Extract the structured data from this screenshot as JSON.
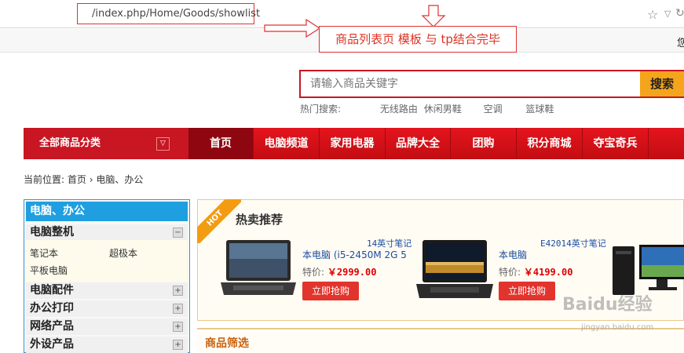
{
  "browser": {
    "url": "/index.php/Home/Goods/showlist",
    "corner_char": "您"
  },
  "annotation": {
    "text": "商品列表页  模板 与 tp结合完毕"
  },
  "search": {
    "placeholder": "请输入商品关键字",
    "button": "搜索",
    "hot_label": "热门搜索:",
    "hot_terms": [
      "无线路由",
      "休闲男鞋",
      "空调",
      "篮球鞋"
    ]
  },
  "nav": {
    "all_categories": "全部商品分类",
    "items": [
      "首页",
      "电脑频道",
      "家用电器",
      "品牌大全",
      "团购",
      "积分商城",
      "夺宝奇兵"
    ]
  },
  "breadcrumb": {
    "label": "当前位置:",
    "home": "首页",
    "sep": "›",
    "current": "电脑、办公"
  },
  "sidebar": {
    "title": "电脑、办公",
    "categories": [
      {
        "name": "电脑整机",
        "expanded": true,
        "subs": [
          "笔记本",
          "超极本",
          "平板电脑"
        ]
      },
      {
        "name": "电脑配件",
        "expanded": false
      },
      {
        "name": "办公打印",
        "expanded": false
      },
      {
        "name": "网络产品",
        "expanded": false
      },
      {
        "name": "外设产品",
        "expanded": false
      }
    ]
  },
  "hot": {
    "ribbon": "HOT",
    "title": "热卖推荐",
    "products": [
      {
        "name_line1": "14英寸笔记",
        "name_line2": "本电脑  (i5-2450M 2G 5",
        "price_label": "特价:",
        "price": "￥2999.00",
        "button": "立即抢购"
      },
      {
        "name_line1": "E42014英寸笔记",
        "name_line2": "本电脑",
        "price_label": "特价:",
        "price": "￥4199.00",
        "button": "立即抢购"
      }
    ]
  },
  "filter": {
    "title": "商品筛选"
  },
  "watermark": {
    "main": "Baidu经验",
    "sub": "jingyan.baidu.com"
  }
}
